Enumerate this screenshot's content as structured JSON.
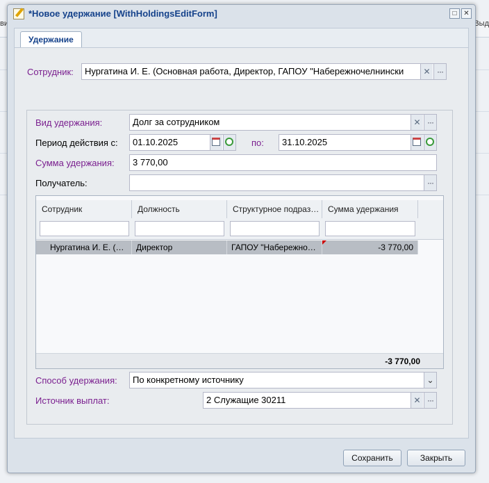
{
  "background": {
    "left_text": "вид",
    "right_text": "Выд"
  },
  "window": {
    "title": "*Новое удержание [WithHoldingsEditForm]",
    "maximize_glyph": "□",
    "close_glyph": "✕"
  },
  "tabs": [
    {
      "label": "Удержание"
    }
  ],
  "form": {
    "employee_label": "Сотрудник:",
    "employee_value": "Нургатина И. Е. (Основная работа, Директор, ГАПОУ \"Набережночелнински",
    "withholding_type_label": "Вид удержания:",
    "withholding_type_value": "Долг за сотрудником",
    "period_from_label": "Период действия с:",
    "period_from_value": "01.10.2025",
    "period_to_label": "по:",
    "period_to_value": "31.10.2025",
    "amount_label": "Сумма удержания:",
    "amount_value": "3 770,00",
    "recipient_label": "Получатель:",
    "recipient_value": "",
    "method_label": "Способ удержания:",
    "method_value": "По конкретному источнику",
    "source_label": "Источник выплат:",
    "source_value": "2 Служащие 30211"
  },
  "grid": {
    "columns": [
      "Сотрудник",
      "Должность",
      "Структурное подраз…",
      "Сумма удержания"
    ],
    "rows": [
      {
        "employee": "Нургатина И. Е. (…",
        "position": "Директор",
        "unit": "ГАПОУ \"Набережно…",
        "amount": "-3 770,00"
      }
    ],
    "total": "-3 770,00"
  },
  "buttons": {
    "save": "Сохранить",
    "close": "Закрыть"
  },
  "icons": {
    "clear": "✕",
    "lookup": "···",
    "dropdown": "⌄"
  },
  "colors": {
    "required_label": "#7a1f8f",
    "title": "#15428b",
    "selected_row": "#b8bdc4"
  }
}
